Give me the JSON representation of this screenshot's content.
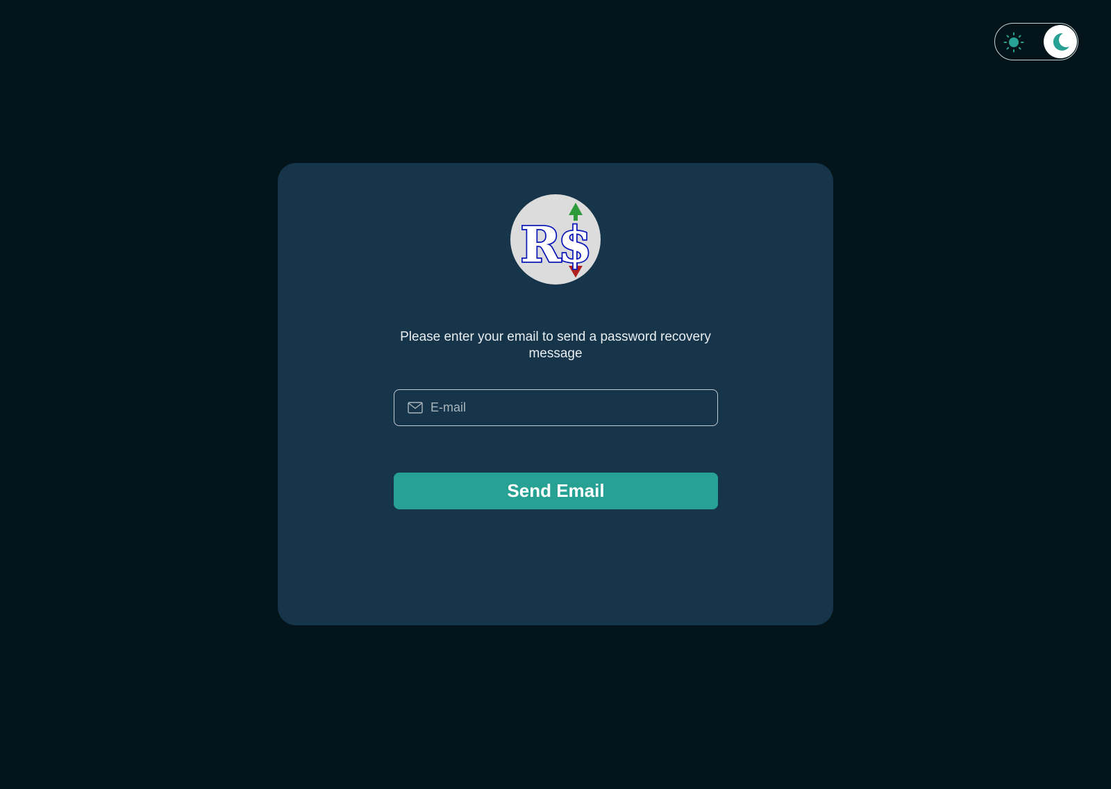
{
  "theme_toggle": {
    "mode": "dark",
    "light_icon": "sun-icon",
    "dark_icon": "moon-icon"
  },
  "logo": {
    "text": "R$",
    "up_arrow_color": "#2e9b3a",
    "down_arrow_color": "#b1211d"
  },
  "recovery": {
    "message": "Please enter your email to send a password recovery message",
    "email_placeholder": "E-mail",
    "email_value": "",
    "email_icon": "mail-icon",
    "submit_label": "Send Email"
  },
  "colors": {
    "background": "#03151a",
    "card": "#17354a",
    "accent": "#27a193"
  }
}
